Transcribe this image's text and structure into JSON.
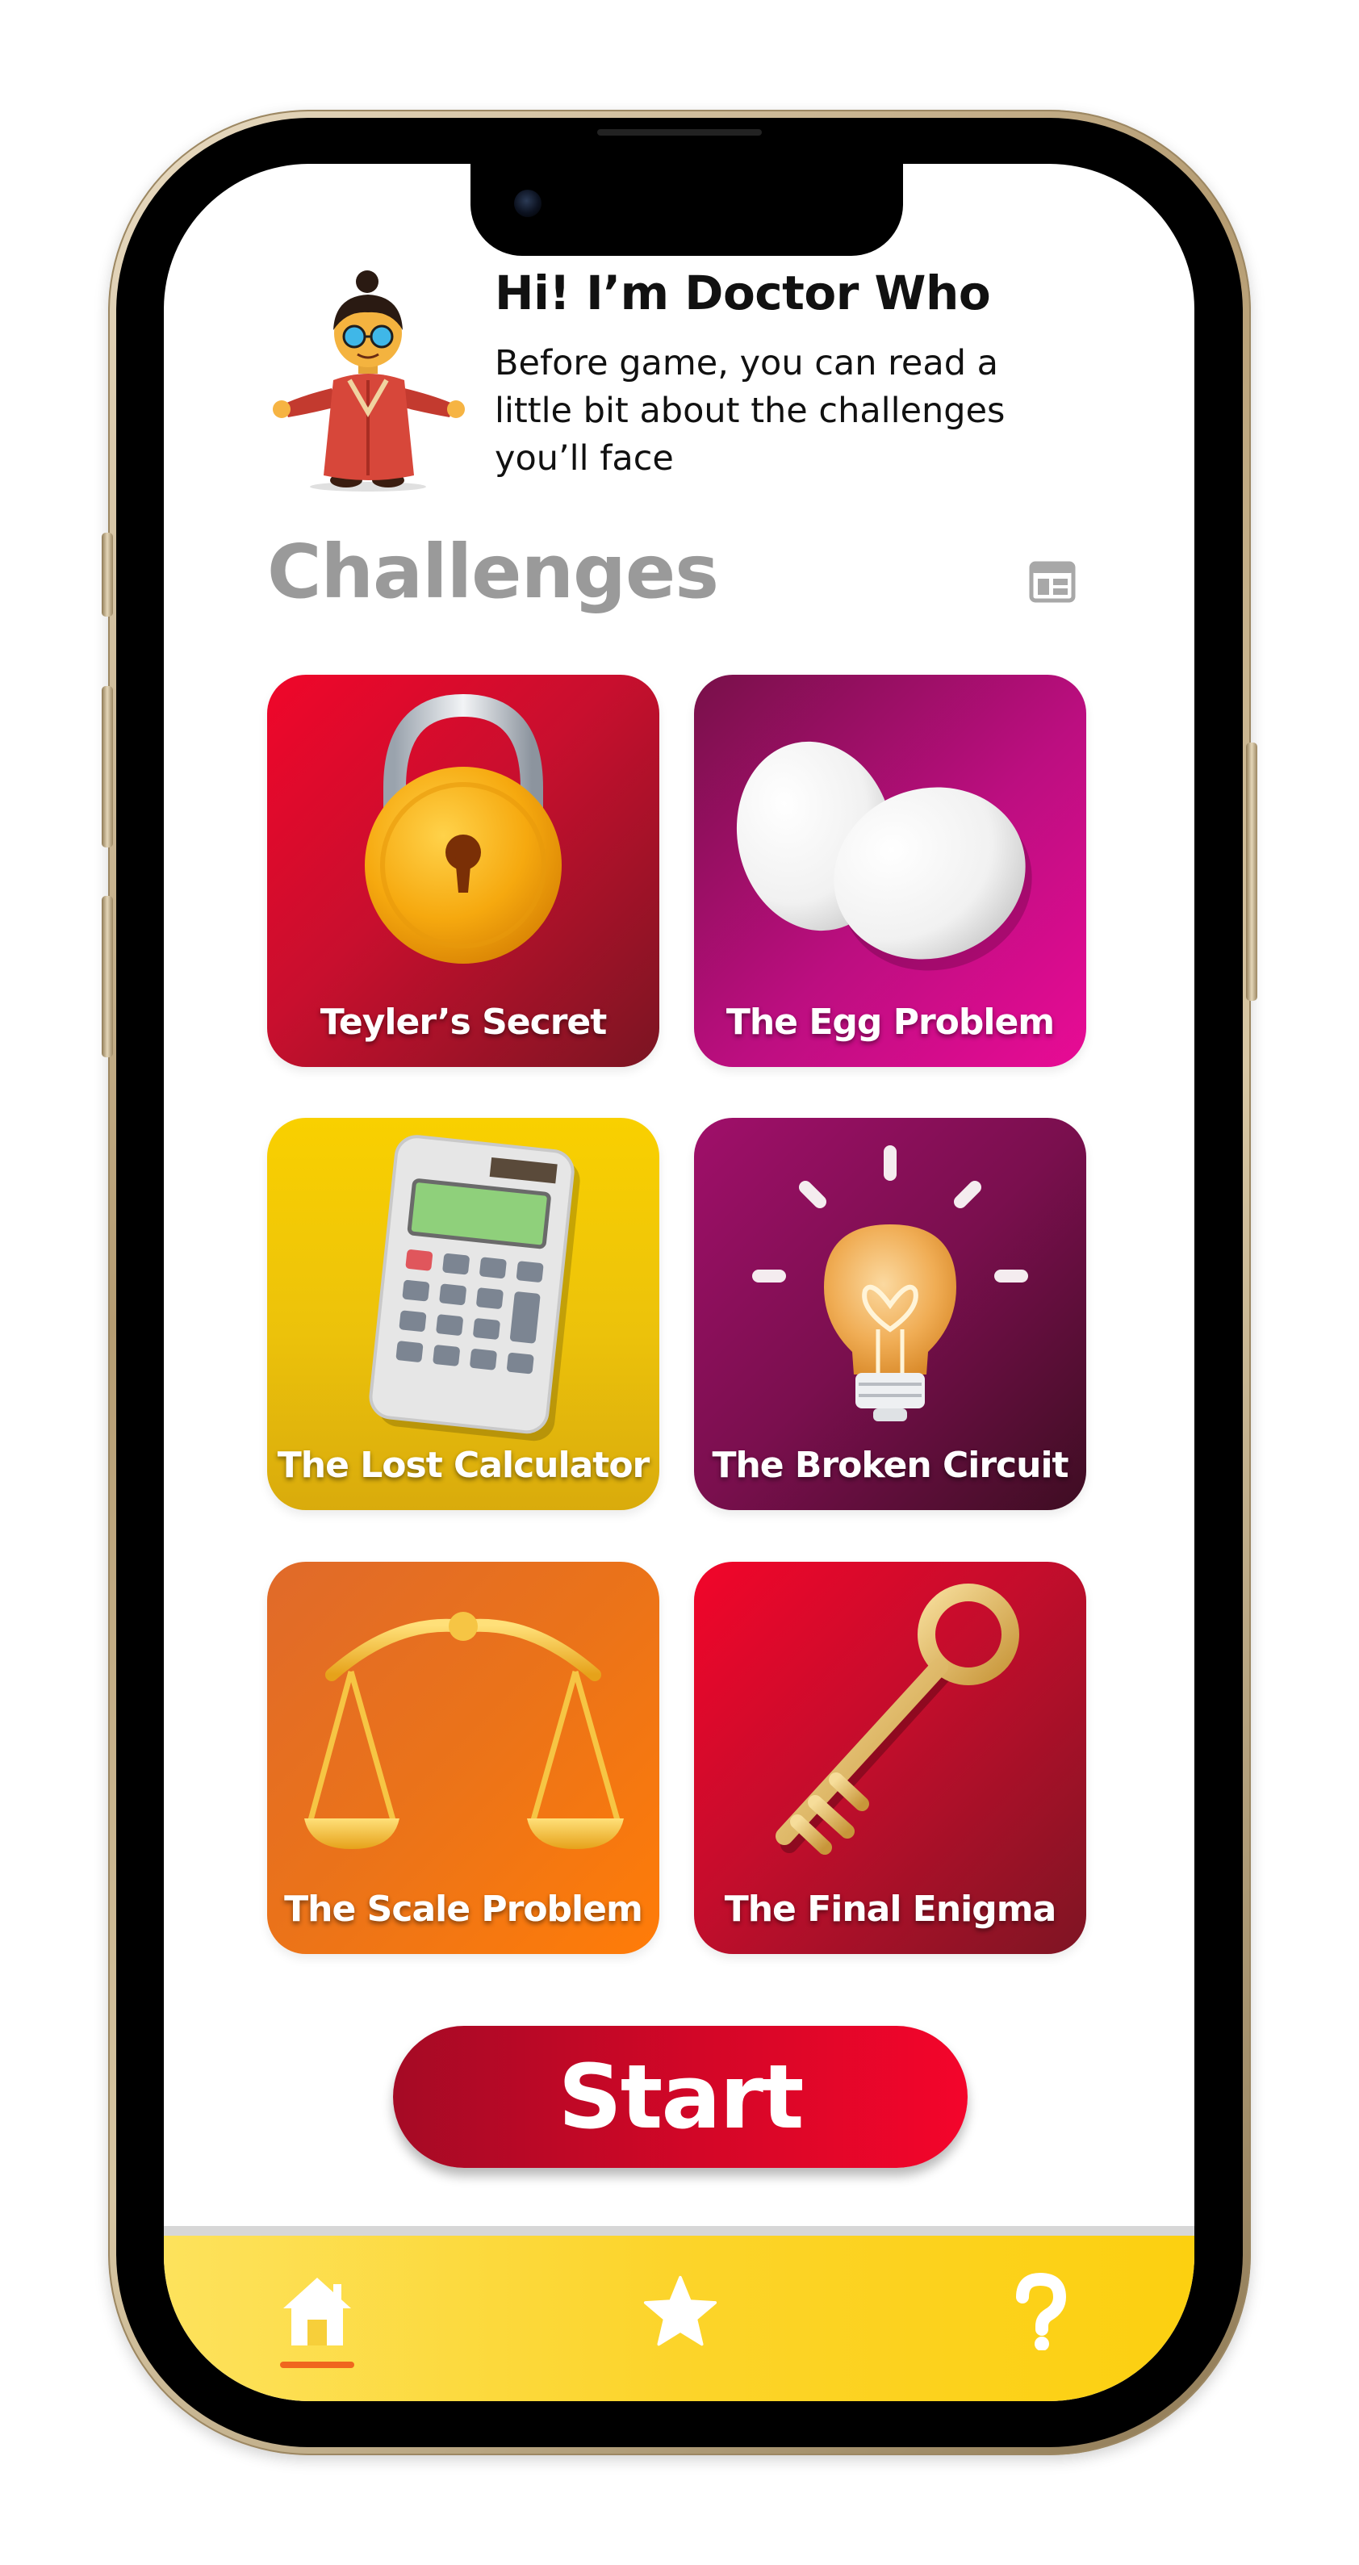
{
  "header": {
    "title": "Hi! I’m Doctor Who",
    "subtitle_lines": [
      "Before game, you can read a",
      "little bit about the challenges",
      "you’ll face"
    ],
    "character_icon": "doctor-character-illustration"
  },
  "section": {
    "title": "Challenges",
    "layout_toggle_icon": "layout-grid-icon"
  },
  "challenges": [
    {
      "label": "Teyler’s Secret",
      "icon": "padlock-icon"
    },
    {
      "label": "The Egg Problem",
      "icon": "eggs-icon"
    },
    {
      "label": "The Lost Calculator",
      "icon": "calculator-icon"
    },
    {
      "label": "The Broken Circuit",
      "icon": "lightbulb-icon"
    },
    {
      "label": "The Scale Problem",
      "icon": "scale-icon"
    },
    {
      "label": "The Final Enigma",
      "icon": "key-icon"
    }
  ],
  "start_button": {
    "label": "Start"
  },
  "tabbar": {
    "tabs": [
      {
        "name": "home",
        "icon": "home-icon",
        "active": true
      },
      {
        "name": "favorites",
        "icon": "star-icon",
        "active": false
      },
      {
        "name": "help",
        "icon": "question-icon",
        "active": false
      }
    ],
    "accent_color": "#f0661e"
  },
  "colors": {
    "primary_red": "#e3082b",
    "tabbar_yellow": "#fcd42a",
    "section_title_gray": "#9a9a9a"
  }
}
